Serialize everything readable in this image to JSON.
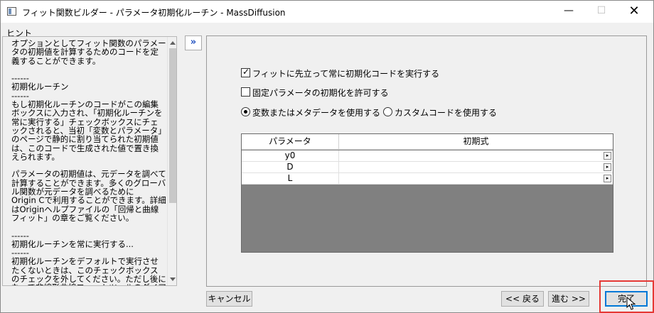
{
  "window": {
    "title": "フィット関数ビルダー - パラメータ初期化ルーチン - MassDiffusion",
    "minimize_glyph": "—",
    "maximize_glyph": "☐",
    "close_glyph": "✕"
  },
  "hint": {
    "label": "ヒント",
    "text": "オプションとしてフィット関数のパラメータの初期値を計算するためのコードを定義することができます。\n\n------\n初期化ルーチン\n------\nもし初期化ルーチンのコードがこの編集ボックスに入力され、「初期化ルーチンを常に実行する」チェックボックスにチェックされると、当初「変数とパラメータ」のページで静的に割り当てられた初期値は、このコードで生成された値で置き換えられます。\n\nパラメータの初期値は、元データを調べて計算することができます。多くのグローバル関数が元データを調べるために\nOrigin Cで利用することができます。詳細はOriginヘルプファイルの「回帰と曲線フィット」の章をご覧ください。\n\n------\n初期化ルーチンを常に実行する...\n------\n初期化ルーチンをデフォルトで実行させたくないときは、このチェックボックスのチェックを外してください。ただし後になって非線形曲線フィットツールのダイアログの中から、初期化ルーチンを実行させることもでき"
  },
  "expand_glyph": "»",
  "options": {
    "always_run_init": {
      "label": "フィットに先立って常に初期化コードを実行する",
      "checked": true
    },
    "allow_fixed_init": {
      "label": "固定パラメータの初期化を許可する",
      "checked": false
    },
    "use_vars_metadata": {
      "label": "変数またはメタデータを使用する",
      "selected": true
    },
    "use_custom_code": {
      "label": "カスタムコードを使用する",
      "selected": false
    }
  },
  "grid": {
    "columns": [
      "パラメータ",
      "初期式"
    ],
    "rows": [
      {
        "param": "y0",
        "expr": ""
      },
      {
        "param": "D",
        "expr": ""
      },
      {
        "param": "L",
        "expr": ""
      }
    ],
    "row_button_glyph": "▸"
  },
  "buttons": {
    "cancel": "キャンセル",
    "back": "<< 戻る",
    "next": "進む >>",
    "finish": "完了"
  },
  "colors": {
    "highlight": "#e53935",
    "accent": "#0078d7",
    "grid_empty": "#808080"
  }
}
